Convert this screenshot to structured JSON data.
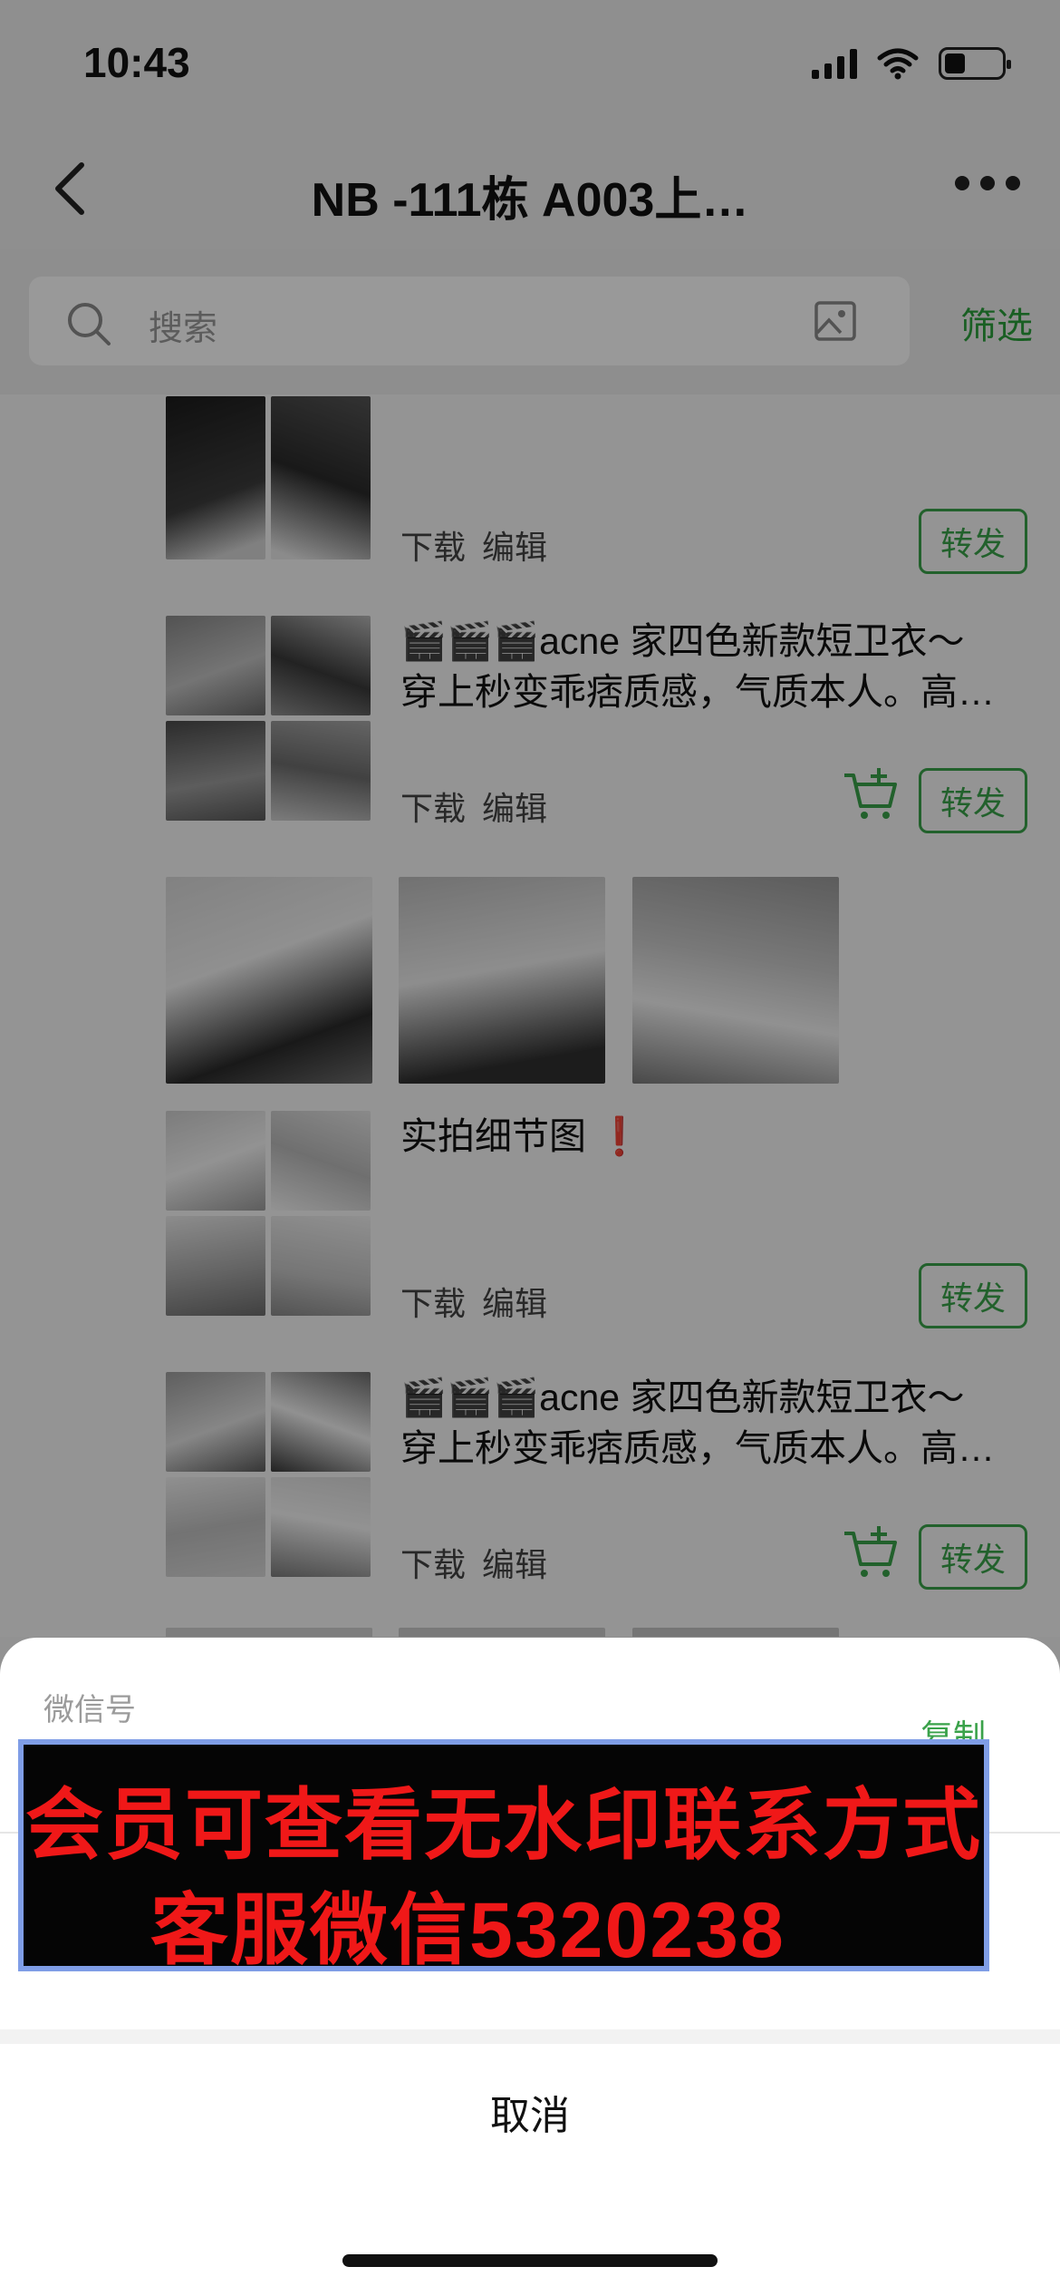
{
  "status_bar": {
    "time": "10:43"
  },
  "nav": {
    "title": "NB -111栋 A003上…"
  },
  "search": {
    "placeholder": "搜索",
    "filter_label": "筛选"
  },
  "actions": {
    "download": "下载",
    "edit": "编辑",
    "forward": "转发"
  },
  "posts": [
    {
      "text_lines": [],
      "has_cart": false
    },
    {
      "text_lines": [
        "🎬🎬🎬acne 家四色新款短卫衣～",
        "穿上秒变乖痞质感，气质本人。高…"
      ],
      "has_cart": true
    },
    {
      "text_lines": [
        "实拍细节图"
      ],
      "exclaim": "❗",
      "has_cart": false
    },
    {
      "text_lines": [
        "🎬🎬🎬acne 家四色新款短卫衣～",
        "穿上秒变乖痞质感，气质本人。高…"
      ],
      "has_cart": true
    }
  ],
  "sheet": {
    "label": "微信号",
    "copy_label": "复制",
    "cancel_label": "取消"
  },
  "watermark": {
    "line1": "会员可查看无水印联系方式",
    "line2": "客服微信5320238"
  },
  "colors": {
    "accent_green": "#3aa24a",
    "watermark_red": "#f01818"
  }
}
